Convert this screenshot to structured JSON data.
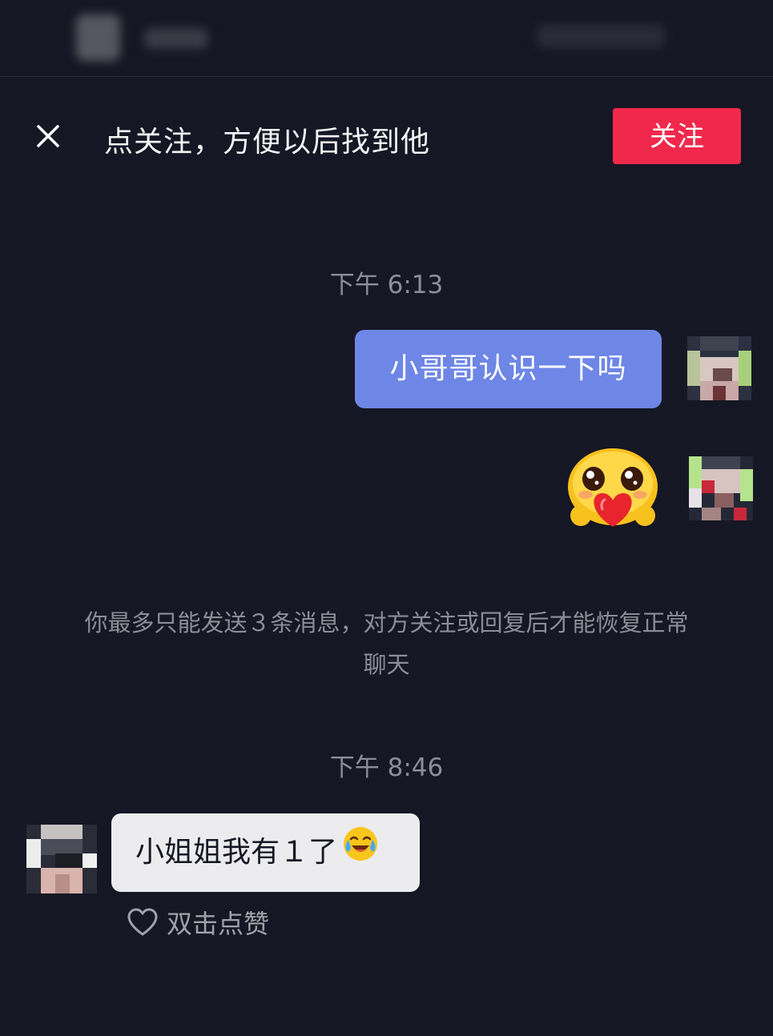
{
  "banner": {
    "close_icon": "close-icon",
    "prompt": "点关注，方便以后找到他",
    "follow_label": "关注",
    "accent": "#f0294c"
  },
  "messages": {
    "time1": "下午 6:13",
    "outgoing_text": "小哥哥认识一下吗",
    "outgoing_color": "#6e86e6",
    "sticker": "blushing-heart-face-sticker",
    "notice": "你最多只能发送３条消息，对方关注或回复后才能恢复正常聊天",
    "time2": "下午 8:46",
    "incoming_text": "小姐姐我有１了",
    "incoming_emoji": "crying-laughing-face-icon",
    "like_label": "双击点赞",
    "like_icon": "heart-outline-icon"
  }
}
